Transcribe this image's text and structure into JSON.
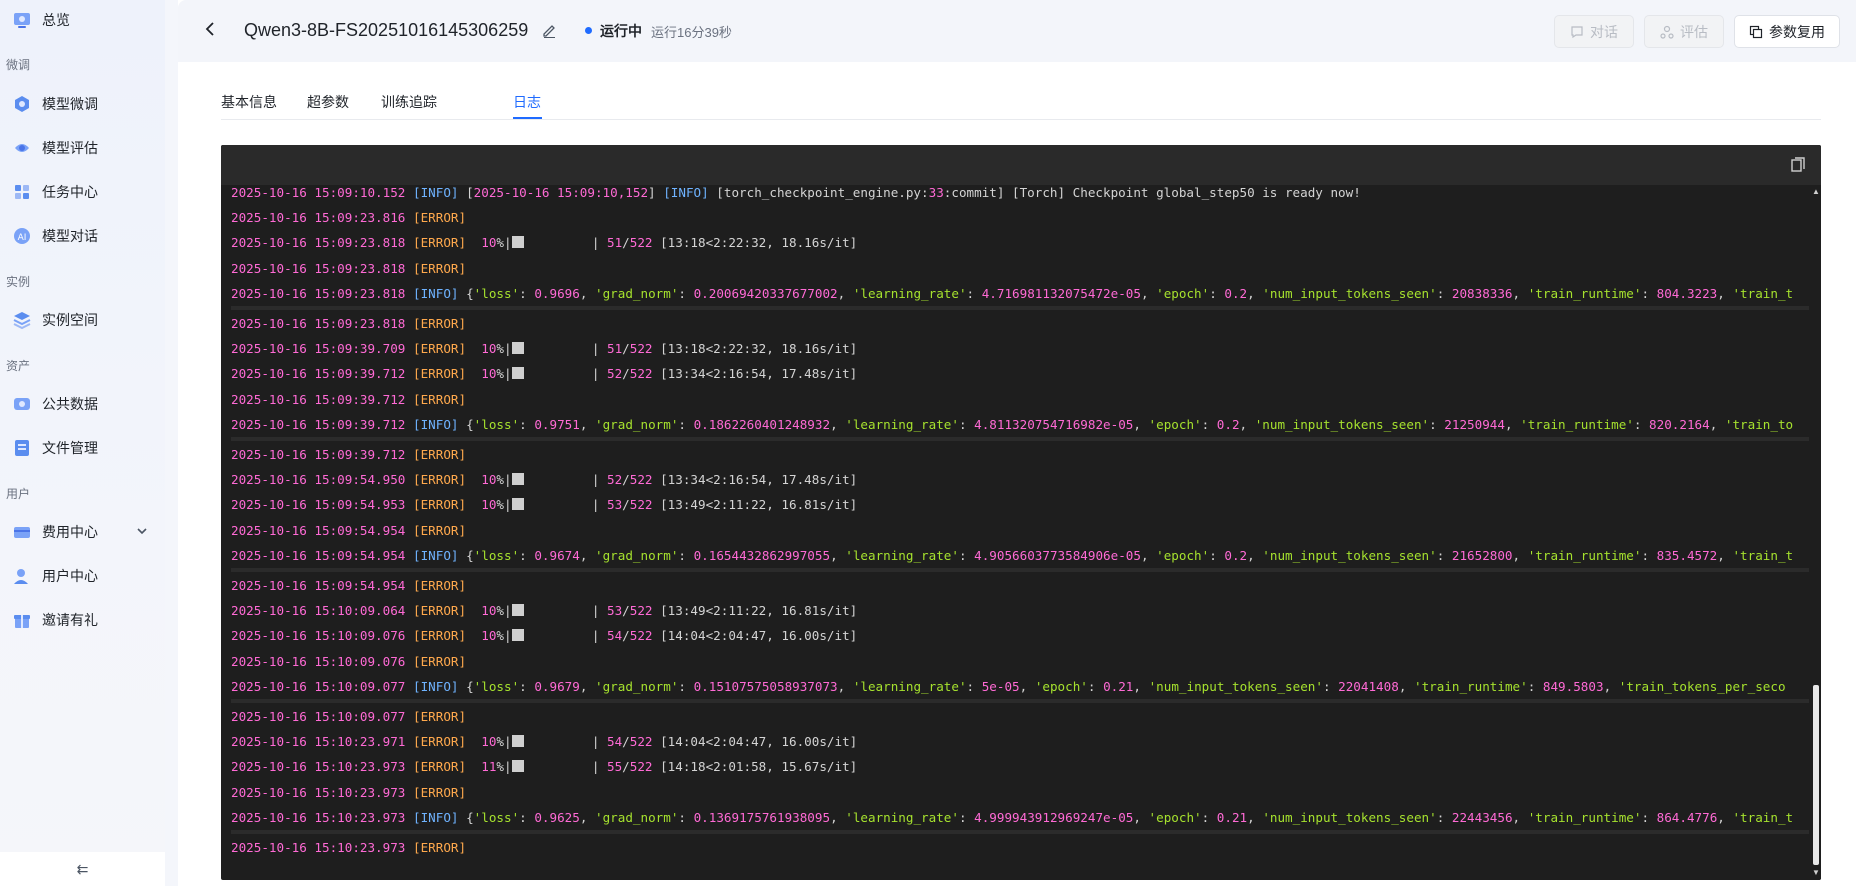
{
  "sidebar": {
    "top_item": "总览",
    "groups": {
      "finetune": "微调",
      "instance": "实例",
      "assets": "资产",
      "user": "用户"
    },
    "items": {
      "model_finetune": "模型微调",
      "model_eval": "模型评估",
      "task_center": "任务中心",
      "model_chat": "模型对话",
      "instance_space": "实例空间",
      "public_data": "公共数据",
      "file_manage": "文件管理",
      "billing": "费用中心",
      "user_center": "用户中心",
      "invite": "邀请有礼"
    },
    "collapse_glyph": "⇇"
  },
  "header": {
    "back_glyph": "‹",
    "title": "Qwen3-8B-FS20251016145306259",
    "status": "运行中",
    "runtime": "运行16分39秒",
    "buttons": {
      "chat": "对话",
      "eval": "评估",
      "reuse": "参数复用"
    }
  },
  "tabs": [
    "基本信息",
    "超参数",
    "训练追踪",
    "日志"
  ],
  "colors": {
    "accent": "#1f6bff",
    "log_bg": "#1e1e1e",
    "timestamp": "#ff6ad5",
    "error": "#ffa94d",
    "info": "#6fb3ff",
    "string": "#a6e22e"
  },
  "log": {
    "first_line": {
      "ts": "2025-10-16 15:09:10.152",
      "level": "[INFO]",
      "msg_a": " [",
      "ts2": "2025-10-16 15:09:10,152",
      "msg_b": "] ",
      "level2": "[INFO]",
      "msg_c": " [torch_checkpoint_engine.py:",
      "line_no": "33",
      "msg_d": ":commit] [Torch] Checkpoint global_step50 is ready now!"
    },
    "blocks": [
      {
        "lines": [
          {
            "ts": "2025-10-16 15:09:23.816",
            "level": "[ERROR]"
          },
          {
            "ts": "2025-10-16 15:09:23.818",
            "level": "[ERROR]",
            "pct": "10%",
            "prog": "51/522",
            "timing": "[13:18<2:22:32, 18.16s/it]"
          },
          {
            "ts": "2025-10-16 15:09:23.818",
            "level": "[ERROR]"
          }
        ],
        "info": {
          "ts": "2025-10-16 15:09:23.818",
          "loss": "0.9696",
          "grad_norm": "0.20069420337677002",
          "lr": "4.716981132075472e-05",
          "epoch": "0.2",
          "tokens": "20838336",
          "runtime": "804.3223",
          "tail": "'train_t"
        }
      },
      {
        "lines": [
          {
            "ts": "2025-10-16 15:09:23.818",
            "level": "[ERROR]"
          },
          {
            "ts": "2025-10-16 15:09:39.709",
            "level": "[ERROR]",
            "pct": "10%",
            "prog": "51/522",
            "timing": "[13:18<2:22:32, 18.16s/it]"
          },
          {
            "ts": "2025-10-16 15:09:39.712",
            "level": "[ERROR]",
            "pct": "10%",
            "prog": "52/522",
            "timing": "[13:34<2:16:54, 17.48s/it]"
          },
          {
            "ts": "2025-10-16 15:09:39.712",
            "level": "[ERROR]"
          }
        ],
        "info": {
          "ts": "2025-10-16 15:09:39.712",
          "loss": "0.9751",
          "grad_norm": "0.1862260401248932",
          "lr": "4.811320754716982e-05",
          "epoch": "0.2",
          "tokens": "21250944",
          "runtime": "820.2164",
          "tail": "'train_to"
        }
      },
      {
        "lines": [
          {
            "ts": "2025-10-16 15:09:39.712",
            "level": "[ERROR]"
          },
          {
            "ts": "2025-10-16 15:09:54.950",
            "level": "[ERROR]",
            "pct": "10%",
            "prog": "52/522",
            "timing": "[13:34<2:16:54, 17.48s/it]"
          },
          {
            "ts": "2025-10-16 15:09:54.953",
            "level": "[ERROR]",
            "pct": "10%",
            "prog": "53/522",
            "timing": "[13:49<2:11:22, 16.81s/it]"
          },
          {
            "ts": "2025-10-16 15:09:54.954",
            "level": "[ERROR]"
          }
        ],
        "info": {
          "ts": "2025-10-16 15:09:54.954",
          "loss": "0.9674",
          "grad_norm": "0.1654432862997055",
          "lr": "4.9056603773584906e-05",
          "epoch": "0.2",
          "tokens": "21652800",
          "runtime": "835.4572",
          "tail": "'train_t"
        }
      },
      {
        "lines": [
          {
            "ts": "2025-10-16 15:09:54.954",
            "level": "[ERROR]"
          },
          {
            "ts": "2025-10-16 15:10:09.064",
            "level": "[ERROR]",
            "pct": "10%",
            "prog": "53/522",
            "timing": "[13:49<2:11:22, 16.81s/it]"
          },
          {
            "ts": "2025-10-16 15:10:09.076",
            "level": "[ERROR]",
            "pct": "10%",
            "prog": "54/522",
            "timing": "[14:04<2:04:47, 16.00s/it]"
          },
          {
            "ts": "2025-10-16 15:10:09.076",
            "level": "[ERROR]"
          }
        ],
        "info": {
          "ts": "2025-10-16 15:10:09.077",
          "loss": "0.9679",
          "grad_norm": "0.15107575058937073",
          "lr": "5e-05",
          "epoch": "0.21",
          "tokens": "22041408",
          "runtime": "849.5803",
          "tail": "'train_tokens_per_seco"
        }
      },
      {
        "lines": [
          {
            "ts": "2025-10-16 15:10:09.077",
            "level": "[ERROR]"
          },
          {
            "ts": "2025-10-16 15:10:23.971",
            "level": "[ERROR]",
            "pct": "10%",
            "prog": "54/522",
            "timing": "[14:04<2:04:47, 16.00s/it]"
          },
          {
            "ts": "2025-10-16 15:10:23.973",
            "level": "[ERROR]",
            "pct": "11%",
            "prog": "55/522",
            "timing": "[14:18<2:01:58, 15.67s/it]"
          },
          {
            "ts": "2025-10-16 15:10:23.973",
            "level": "[ERROR]"
          }
        ],
        "info": {
          "ts": "2025-10-16 15:10:23.973",
          "loss": "0.9625",
          "grad_norm": "0.1369175761938095",
          "lr": "4.999943912969247e-05",
          "epoch": "0.21",
          "tokens": "22443456",
          "runtime": "864.4776",
          "tail": "'train_t"
        }
      }
    ],
    "last_line": {
      "ts": "2025-10-16 15:10:23.973",
      "level": "[ERROR]"
    }
  }
}
